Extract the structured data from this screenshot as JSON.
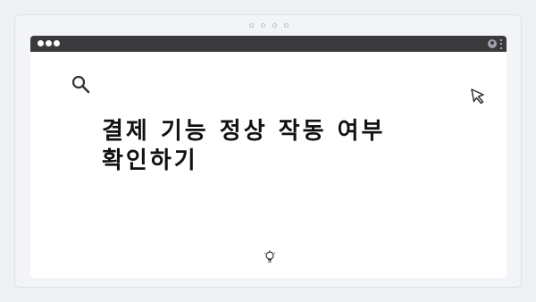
{
  "slide": {
    "title": "결제 기능 정상 작동 여부\n확인하기"
  },
  "icons": {
    "search": "search-icon",
    "cursor": "cursor-arrow-icon",
    "bulb": "lightbulb-icon",
    "user": "user-icon",
    "menu": "kebab-menu-icon"
  },
  "colors": {
    "toolbar": "#3a3a3c",
    "background": "#eef0f4",
    "content": "#ffffff",
    "text": "#111111"
  }
}
